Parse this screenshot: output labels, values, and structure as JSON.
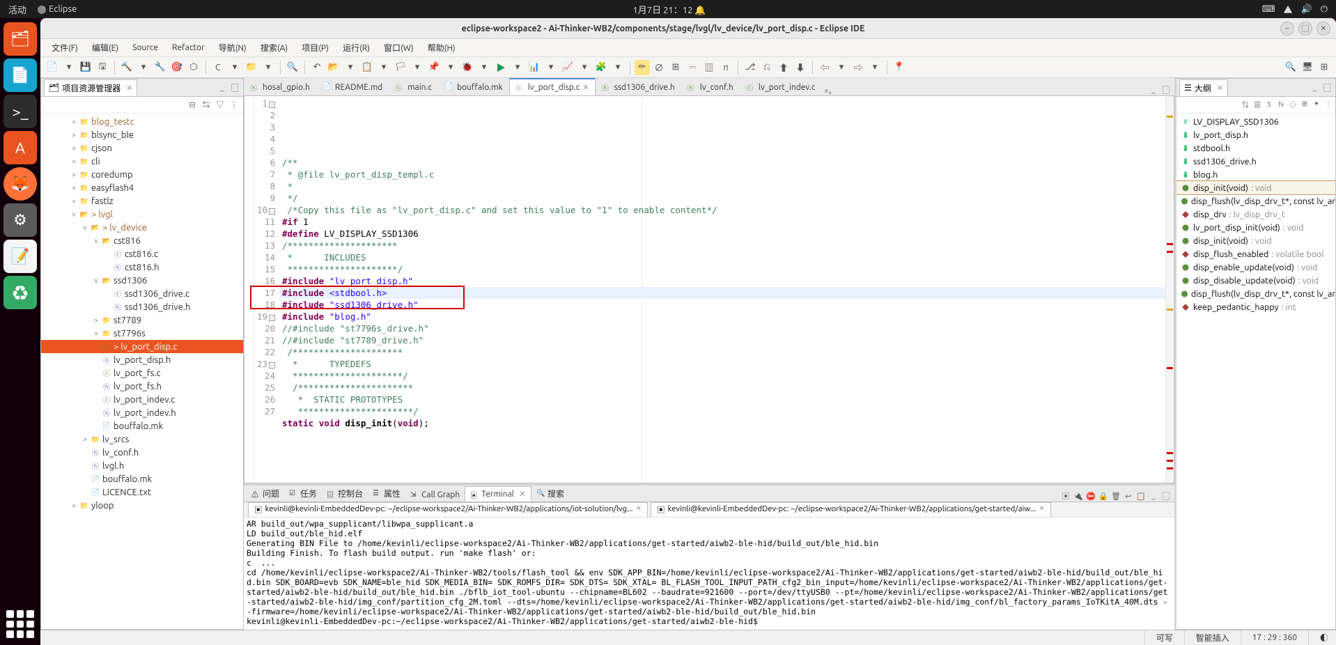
{
  "sysbar": {
    "activities": "活动",
    "app": "Eclipse",
    "datetime": "1月7日 21：12"
  },
  "window": {
    "title": "eclipse-workspace2 - Ai-Thinker-WB2/components/stage/lvgl/lv_device/lv_port_disp.c - Eclipse IDE"
  },
  "menu": {
    "file": "文件(F)",
    "edit": "编辑(E)",
    "source": "Source",
    "refactor": "Refactor",
    "navigate": "导航(N)",
    "search": "搜索(A)",
    "project": "项目(P)",
    "run": "运行(R)",
    "window": "窗口(W)",
    "help": "帮助(H)"
  },
  "explorer": {
    "title": "项目资源管理器",
    "items": [
      {
        "d": 2,
        "exp": ">",
        "icon": "folder",
        "label": "blog_testc",
        "dirty": true
      },
      {
        "d": 2,
        "exp": ">",
        "icon": "folder",
        "label": "blsync_ble"
      },
      {
        "d": 2,
        "exp": ">",
        "icon": "folder",
        "label": "cjson"
      },
      {
        "d": 2,
        "exp": ">",
        "icon": "folder",
        "label": "cli"
      },
      {
        "d": 2,
        "exp": ">",
        "icon": "folder",
        "label": "coredump"
      },
      {
        "d": 2,
        "exp": ">",
        "icon": "folder",
        "label": "easyflash4"
      },
      {
        "d": 2,
        "exp": ">",
        "icon": "folder",
        "label": "fastlz"
      },
      {
        "d": 2,
        "exp": "v",
        "icon": "folder-open",
        "label": "> lvgl",
        "dirty": true
      },
      {
        "d": 3,
        "exp": "v",
        "icon": "folder-open",
        "label": "> lv_device",
        "dirty": true
      },
      {
        "d": 4,
        "exp": "v",
        "icon": "folder-open",
        "label": "cst816"
      },
      {
        "d": 5,
        "exp": "",
        "icon": "cfile",
        "label": "cst816.c"
      },
      {
        "d": 5,
        "exp": "",
        "icon": "hfile",
        "label": "cst816.h"
      },
      {
        "d": 4,
        "exp": "v",
        "icon": "folder-open",
        "label": "ssd1306"
      },
      {
        "d": 5,
        "exp": "",
        "icon": "cfile",
        "label": "ssd1306_drive.c"
      },
      {
        "d": 5,
        "exp": "",
        "icon": "hfile",
        "label": "ssd1306_drive.h"
      },
      {
        "d": 4,
        "exp": ">",
        "icon": "folder",
        "label": "st7789"
      },
      {
        "d": 4,
        "exp": ">",
        "icon": "folder",
        "label": "st7796s"
      },
      {
        "d": 4,
        "exp": "",
        "icon": "cfile",
        "label": "> lv_port_disp.c",
        "selected": true,
        "dirty": true
      },
      {
        "d": 4,
        "exp": "",
        "icon": "hfile",
        "label": "lv_port_disp.h"
      },
      {
        "d": 4,
        "exp": "",
        "icon": "cfile",
        "label": "lv_port_fs.c"
      },
      {
        "d": 4,
        "exp": "",
        "icon": "hfile",
        "label": "lv_port_fs.h"
      },
      {
        "d": 4,
        "exp": "",
        "icon": "cfile",
        "label": "lv_port_indev.c"
      },
      {
        "d": 4,
        "exp": "",
        "icon": "hfile",
        "label": "lv_port_indev.h"
      },
      {
        "d": 4,
        "exp": "",
        "icon": "mk",
        "label": "bouffalo.mk"
      },
      {
        "d": 3,
        "exp": ">",
        "icon": "folder",
        "label": "lv_srcs"
      },
      {
        "d": 3,
        "exp": "",
        "icon": "hfile",
        "label": "lv_conf.h"
      },
      {
        "d": 3,
        "exp": "",
        "icon": "hfile",
        "label": "lvgl.h"
      },
      {
        "d": 3,
        "exp": "",
        "icon": "mk",
        "label": "bouffalo.mk"
      },
      {
        "d": 3,
        "exp": "",
        "icon": "txtfile",
        "label": "LICENCE.txt"
      },
      {
        "d": 2,
        "exp": ">",
        "icon": "folder",
        "label": "yloop"
      }
    ]
  },
  "editorTabs": [
    {
      "icon": "hfile",
      "label": "hosal_gpio.h"
    },
    {
      "icon": "txtfile",
      "label": "README.md"
    },
    {
      "icon": "cfile",
      "label": "main.c"
    },
    {
      "icon": "mk",
      "label": "bouffalo.mk"
    },
    {
      "icon": "cfile",
      "label": "lv_port_disp.c",
      "active": true
    },
    {
      "icon": "hfile",
      "label": "ssd1306_drive.h"
    },
    {
      "icon": "hfile",
      "label": "lv_conf.h"
    },
    {
      "icon": "cfile",
      "label": "lv_port_indev.c"
    }
  ],
  "editorMore": "»₄",
  "code": {
    "lines": [
      {
        "n": 1,
        "fold": "-",
        "html": "<span class='cm'>/**</span>"
      },
      {
        "n": 2,
        "html": "<span class='cm'> * @file lv_port_disp_templ.c</span>"
      },
      {
        "n": 3,
        "html": "<span class='cm'> *</span>"
      },
      {
        "n": 4,
        "html": "<span class='cm'> */</span>"
      },
      {
        "n": 5,
        "html": ""
      },
      {
        "n": 6,
        "html": " <span class='cm'>/*Copy this file as \"lv_port_disp.c\" and set this value to \"1\" to enable content*/</span>"
      },
      {
        "n": 7,
        "html": "<span class='dir'>#if</span> <span class='mac'>1</span>"
      },
      {
        "n": 8,
        "html": "<span class='dir'>#define</span> <span class='mac'>LV_DISPLAY_SSD1306</span>"
      },
      {
        "n": 9,
        "html": ""
      },
      {
        "n": 10,
        "fold": "-",
        "html": "<span class='cm'>/*********************</span>"
      },
      {
        "n": 11,
        "html": "<span class='cm'> *      INCLUDES</span>"
      },
      {
        "n": 12,
        "html": "<span class='cm'> *********************/</span>"
      },
      {
        "n": 13,
        "html": "<span class='dir'>#include</span> <span class='str'>\"lv_port_disp.h\"</span>"
      },
      {
        "n": 14,
        "html": "<span class='dir'>#include</span> <span class='str'>&lt;stdbool.h&gt;</span>"
      },
      {
        "n": 15,
        "html": "<span class='dir'>#include</span> <span class='str'>\"ssd1306_drive.h\"</span>"
      },
      {
        "n": 16,
        "html": "<span class='dir'>#include</span> <span class='str'>\"blog.h\"</span>"
      },
      {
        "n": 17,
        "html": "<span class='cm'>//#include \"st7796s_drive.h\"</span>"
      },
      {
        "n": 18,
        "html": "<span class='cm'>//#include \"st7789_drive.h\"</span>"
      },
      {
        "n": 19,
        "fold": "-",
        "html": " <span class='cm'>/*********************</span>"
      },
      {
        "n": 20,
        "html": "<span class='cm'>  *      TYPEDEFS</span>"
      },
      {
        "n": 21,
        "html": "<span class='cm'>  *********************/</span>"
      },
      {
        "n": 22,
        "html": ""
      },
      {
        "n": 23,
        "fold": "-",
        "html": "  <span class='cm'>/**********************</span>"
      },
      {
        "n": 24,
        "html": "<span class='cm'>   *  STATIC PROTOTYPES</span>"
      },
      {
        "n": 25,
        "html": "<span class='cm'>   **********************/</span>"
      },
      {
        "n": 26,
        "html": "<span class='kw'>static</span> <span class='kw'>void</span> <span class='fn'>disp_init</span>(<span class='kw'>void</span>);"
      },
      {
        "n": 27,
        "html": ""
      }
    ]
  },
  "outline": {
    "title": "大纲",
    "items": [
      {
        "ic": "#",
        "label": "LV_DISPLAY_SSD1306"
      },
      {
        "ic": "inc",
        "label": "lv_port_disp.h"
      },
      {
        "ic": "inc",
        "label": "stdbool.h"
      },
      {
        "ic": "inc",
        "label": "ssd1306_drive.h"
      },
      {
        "ic": "inc",
        "label": "blog.h"
      },
      {
        "ic": "fn",
        "label": "disp_init(void)",
        "ret": " : void",
        "sel": true
      },
      {
        "ic": "fn",
        "label": "disp_flush(lv_disp_drv_t*, const lv_ar"
      },
      {
        "ic": "var",
        "label": "disp_drv",
        "ret": " : lv_disp_drv_t"
      },
      {
        "ic": "fn",
        "label": "lv_port_disp_init(void)",
        "ret": " : void"
      },
      {
        "ic": "fn",
        "label": "disp_init(void)",
        "ret": " : void"
      },
      {
        "ic": "var",
        "label": "disp_flush_enabled",
        "ret": " : volatile bool"
      },
      {
        "ic": "fn",
        "label": "disp_enable_update(void)",
        "ret": " : void"
      },
      {
        "ic": "fn",
        "label": "disp_disable_update(void)",
        "ret": " : void"
      },
      {
        "ic": "fn",
        "label": "disp_flush(lv_disp_drv_t*, const lv_ar"
      },
      {
        "ic": "var",
        "label": "keep_pedantic_happy",
        "ret": " : int"
      }
    ]
  },
  "bottomTabs": {
    "problems": "问题",
    "tasks": "任务",
    "console": "控制台",
    "properties": "属性",
    "callgraph": "Call Graph",
    "terminal": "Terminal",
    "search": "搜索"
  },
  "termTabs": [
    {
      "label": "kevinli@kevinli-EmbeddedDev-pc: ~/eclipse-workspace2/Ai-Thinker-WB2/applications/iot-solution/lvg..."
    },
    {
      "label": "kevinli@kevinli-EmbeddedDev-pc: ~/eclipse-workspace2/Ai-Thinker-WB2/applications/get-started/aiw..."
    }
  ],
  "termBody": "AR build_out/wpa_supplicant/libwpa_supplicant.a\nLD build_out/ble_hid.elf\nGenerating BIN File to /home/kevinli/eclipse-workspace2/Ai-Thinker-WB2/applications/get-started/aiwb2-ble-hid/build_out/ble_hid.bin\nBuilding Finish. To flash build output. run 'make flash' or:\nc  ...\ncd /home/kevinli/eclipse-workspace2/Ai-Thinker-WB2/tools/flash_tool && env SDK_APP_BIN=/home/kevinli/eclipse-workspace2/Ai-Thinker-WB2/applications/get-started/aiwb2-ble-hid/build_out/ble_hid.bin SDK_BOARD=evb SDK_NAME=ble_hid SDK_MEDIA_BIN= SDK_ROMFS_DIR= SDK_DTS= SDK_XTAL= BL_FLASH_TOOL_INPUT_PATH_cfg2_bin_input=/home/kevinli/eclipse-workspace2/Ai-Thinker-WB2/applications/get-started/aiwb2-ble-hid/build_out/ble_hid.bin ./bflb_iot_tool-ubuntu --chipname=BL602 --baudrate=921600 --port=/dev/ttyUSB0 --pt=/home/kevinli/eclipse-workspace2/Ai-Thinker-WB2/applications/get-started/aiwb2-ble-hid/img_conf/partition_cfg_2M.toml --dts=/home/kevinli/eclipse-workspace2/Ai-Thinker-WB2/applications/get-started/aiwb2-ble-hid/img_conf/bl_factory_params_IoTKitA_40M.dts --firmware=/home/kevinli/eclipse-workspace2/Ai-Thinker-WB2/applications/get-started/aiwb2-ble-hid/build_out/ble_hid.bin\nkevinli@kevinli-EmbeddedDev-pc:~/eclipse-workspace2/Ai-Thinker-WB2/applications/get-started/aiwb2-ble-hid$",
  "status": {
    "writable": "可写",
    "insert": "智能插入",
    "pos": "17 : 29 : 360"
  }
}
